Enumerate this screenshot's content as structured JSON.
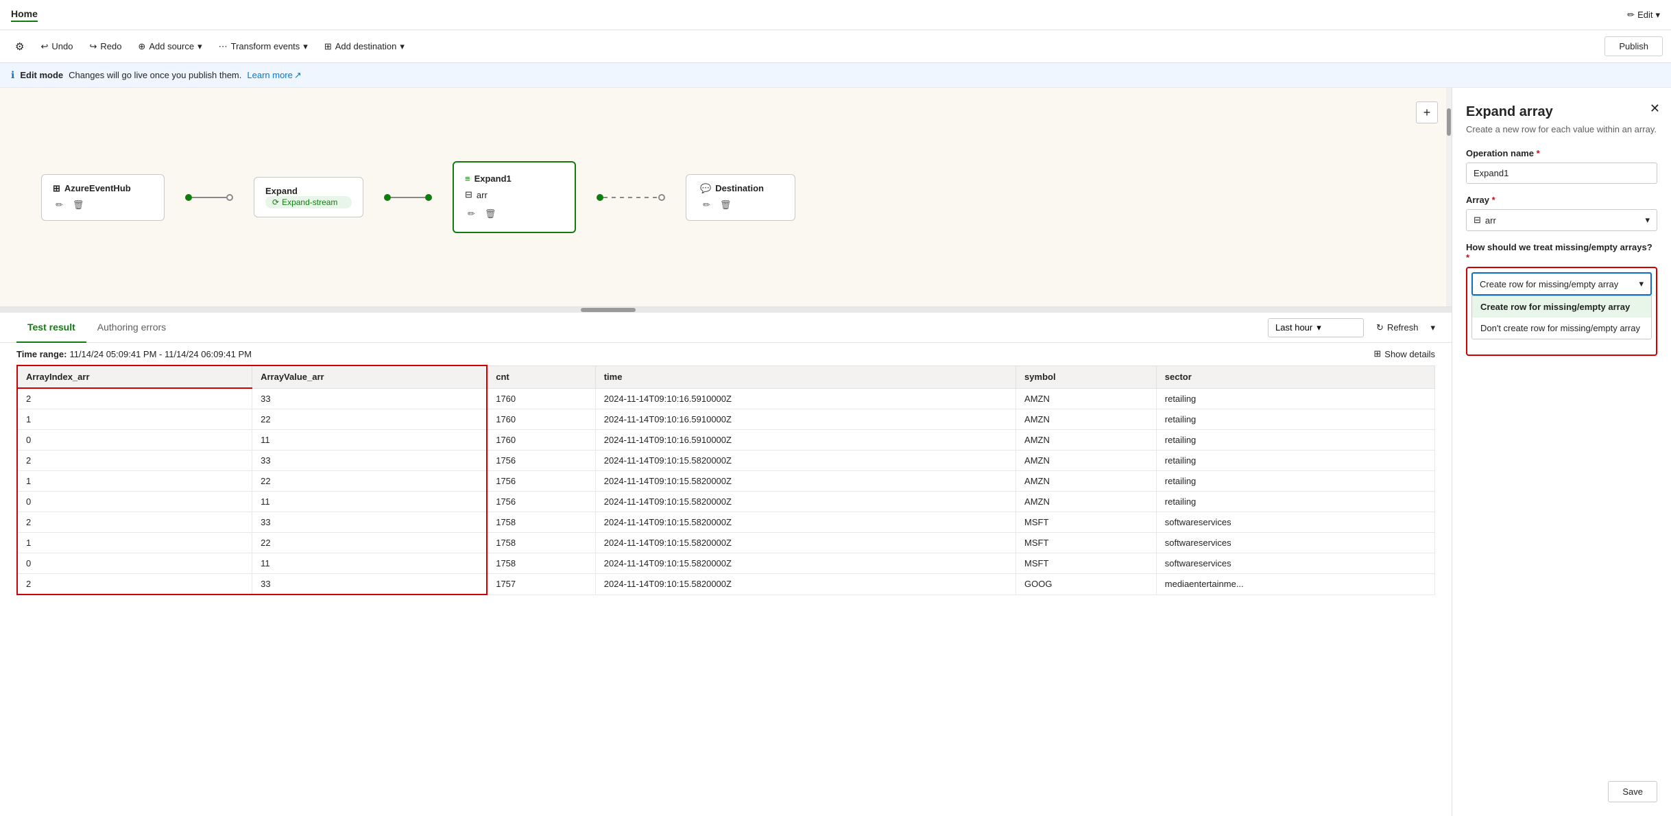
{
  "topbar": {
    "title": "Home",
    "edit_label": "Edit"
  },
  "toolbar": {
    "settings_icon": "⚙",
    "undo_label": "Undo",
    "redo_label": "Redo",
    "add_source_label": "Add source",
    "transform_events_label": "Transform events",
    "add_destination_label": "Add destination",
    "publish_label": "Publish"
  },
  "infobar": {
    "mode_label": "Edit mode",
    "message": "Changes will go live once you publish them.",
    "learn_more_label": "Learn more"
  },
  "flow": {
    "nodes": [
      {
        "id": "azure-event-hub",
        "title": "AzureEventHub",
        "icon": "⊞"
      },
      {
        "id": "expand",
        "title": "Expand",
        "subtitle": "Expand-stream"
      },
      {
        "id": "expand1",
        "title": "Expand1",
        "subtitle": "arr",
        "selected": true
      },
      {
        "id": "destination",
        "title": "Destination",
        "icon": "💬"
      }
    ],
    "plus_icon": "+"
  },
  "bottom_panel": {
    "tabs": [
      {
        "id": "test-result",
        "label": "Test result",
        "active": true
      },
      {
        "id": "authoring-errors",
        "label": "Authoring errors",
        "active": false
      }
    ],
    "time_range_label": "Time range:",
    "time_range_value": "11/14/24 05:09:41 PM - 11/14/24 06:09:41 PM",
    "time_select": "Last hour",
    "refresh_label": "Refresh",
    "show_details_label": "Show details",
    "table": {
      "columns": [
        "ArrayIndex_arr",
        "ArrayValue_arr",
        "cnt",
        "time",
        "symbol",
        "sector"
      ],
      "rows": [
        [
          "2",
          "33",
          "1760",
          "2024-11-14T09:10:16.5910000Z",
          "AMZN",
          "retailing"
        ],
        [
          "1",
          "22",
          "1760",
          "2024-11-14T09:10:16.5910000Z",
          "AMZN",
          "retailing"
        ],
        [
          "0",
          "11",
          "1760",
          "2024-11-14T09:10:16.5910000Z",
          "AMZN",
          "retailing"
        ],
        [
          "2",
          "33",
          "1756",
          "2024-11-14T09:10:15.5820000Z",
          "AMZN",
          "retailing"
        ],
        [
          "1",
          "22",
          "1756",
          "2024-11-14T09:10:15.5820000Z",
          "AMZN",
          "retailing"
        ],
        [
          "0",
          "11",
          "1756",
          "2024-11-14T09:10:15.5820000Z",
          "AMZN",
          "retailing"
        ],
        [
          "2",
          "33",
          "1758",
          "2024-11-14T09:10:15.5820000Z",
          "MSFT",
          "softwareservices"
        ],
        [
          "1",
          "22",
          "1758",
          "2024-11-14T09:10:15.5820000Z",
          "MSFT",
          "softwareservices"
        ],
        [
          "0",
          "11",
          "1758",
          "2024-11-14T09:10:15.5820000Z",
          "MSFT",
          "softwareservices"
        ],
        [
          "2",
          "33",
          "1757",
          "2024-11-14T09:10:15.5820000Z",
          "GOOG",
          "mediaentertainme..."
        ]
      ]
    }
  },
  "right_panel": {
    "title": "Expand array",
    "subtitle": "Create a new row for each value within an array.",
    "close_icon": "✕",
    "operation_name_label": "Operation name",
    "operation_name_value": "Expand1",
    "array_label": "Array",
    "array_value": "arr",
    "array_icon": "⊟",
    "missing_label": "How should we treat missing/empty arrays?",
    "missing_selected": "Create row for missing/empty array",
    "missing_options": [
      {
        "label": "Create row for missing/empty array",
        "selected": true
      },
      {
        "label": "Don't create row for missing/empty array",
        "selected": false
      }
    ],
    "save_label": "Save"
  },
  "colors": {
    "green": "#107c10",
    "red": "#d00000",
    "blue": "#0078d4"
  }
}
